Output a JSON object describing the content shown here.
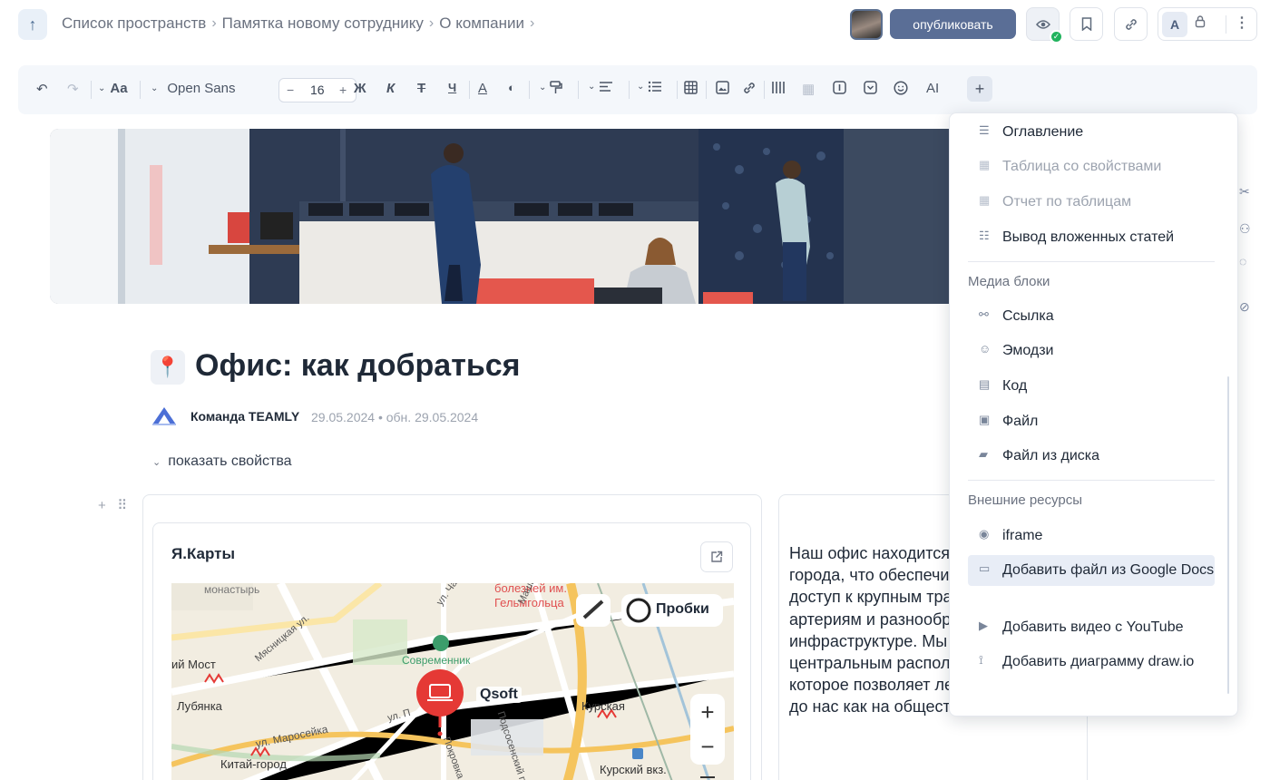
{
  "breadcrumb": {
    "items": [
      "Список пространств",
      "Памятка новому сотруднику",
      "О компании"
    ],
    "separator": "›"
  },
  "header": {
    "publish_label": "опубликовать",
    "appearance_label": "A"
  },
  "toolbar": {
    "font_family": "Open Sans",
    "font_size": "16",
    "text_style_label": "Aa",
    "bold": "Ж",
    "italic": "К",
    "strike": "Т",
    "underline": "Ч",
    "text_color": "A",
    "ai_label": "AI"
  },
  "page": {
    "title": "Офис: как добраться",
    "author": "Команда TEAMLY",
    "dates": "29.05.2024 • обн. 29.05.2024",
    "show_properties": "показать свойства"
  },
  "map_card": {
    "title": "Я.Карты",
    "traffic_label": "Пробки",
    "marker_label": "Qsoft",
    "zoom_in": "+",
    "zoom_out": "−",
    "labels": {
      "monastyri": "монастырь",
      "hospital": "болезней им.\nГельмгольца",
      "sovremennik": "Современник",
      "most": "ий Мост",
      "lubyanka": "Лубянка",
      "maroseyka": "ул. Маросейка",
      "kitay_gorod": "Китай-город",
      "kurskaya": "Курская",
      "kursky_vokzal": "Курский вкз.",
      "chaplygina": "ул. Чаплыгина",
      "mashkova": "Машкова ул.",
      "myasnitskaya": "Мясницкая ул.",
      "pokrovka": "Покровка",
      "podsosensky": "Подсосенский пер.",
      "ul_short": "ул. П"
    }
  },
  "text_block": {
    "paragraph": "Наш офис находится в сердце города, что обеспечивает удобный доступ к крупным транспортным артериям и разнообразной городской инфраструктуре. Мы гордимся нашим центральным расположением, которое позволяет легко добраться до нас как на общественном"
  },
  "insert_menu": {
    "top_items": [
      {
        "label": "Оглавление",
        "icon": "toc-icon",
        "disabled": false
      },
      {
        "label": "Таблица со свойствами",
        "icon": "table-props-icon",
        "disabled": true
      },
      {
        "label": "Отчет по таблицам",
        "icon": "report-icon",
        "disabled": true
      },
      {
        "label": "Вывод вложенных статей",
        "icon": "list-icon",
        "disabled": false
      }
    ],
    "media_header": "Медиа блоки",
    "media_items": [
      {
        "label": "Ссылка",
        "icon": "link-icon"
      },
      {
        "label": "Эмодзи",
        "icon": "emoji-icon"
      },
      {
        "label": "Код",
        "icon": "code-icon"
      },
      {
        "label": "Файл",
        "icon": "image-icon"
      },
      {
        "label": "Файл из диска",
        "icon": "folder-icon"
      }
    ],
    "external_header": "Внешние ресурсы",
    "external_items": [
      {
        "label": "iframe",
        "icon": "eye-icon"
      },
      {
        "label": "Добавить файл из Google Docs",
        "icon": "doc-icon",
        "highlight": true
      },
      {
        "label": "Добавить видео с YouTube",
        "icon": "youtube-icon"
      },
      {
        "label": "Добавить диаграмму draw.io",
        "icon": "diagram-icon"
      }
    ]
  },
  "colors": {
    "accent": "#5a6e96",
    "marker": "#e53935",
    "online": "#22b35e"
  }
}
